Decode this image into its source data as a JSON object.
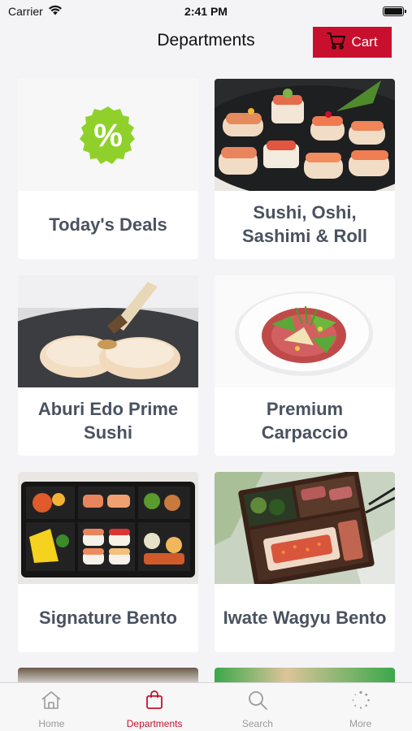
{
  "status_bar": {
    "carrier": "Carrier",
    "time": "2:41 PM"
  },
  "header": {
    "title": "Departments",
    "cart_label": "Cart"
  },
  "departments": [
    {
      "label": "Today's Deals"
    },
    {
      "label": "Sushi, Oshi, Sashimi & Roll"
    },
    {
      "label": "Aburi Edo Prime Sushi"
    },
    {
      "label": "Premium Carpaccio"
    },
    {
      "label": "Signature Bento"
    },
    {
      "label": "Iwate Wagyu Bento"
    }
  ],
  "tabs": [
    {
      "label": "Home",
      "icon": "home-icon",
      "active": false
    },
    {
      "label": "Departments",
      "icon": "shopping-bag-icon",
      "active": true
    },
    {
      "label": "Search",
      "icon": "search-icon",
      "active": false
    },
    {
      "label": "More",
      "icon": "more-icon",
      "active": false
    }
  ],
  "colors": {
    "accent": "#c8102e",
    "deals_badge": "#8fd12a",
    "label_text": "#4a5260"
  }
}
